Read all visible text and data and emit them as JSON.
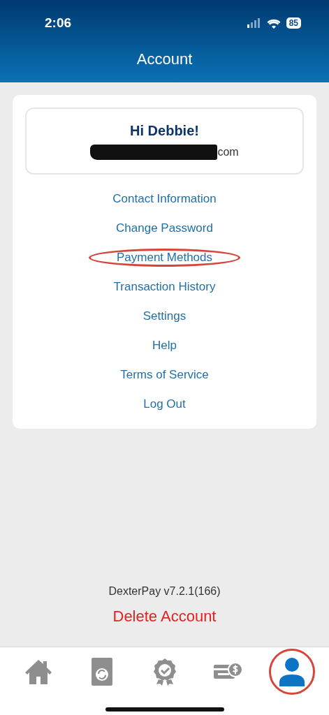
{
  "status_bar": {
    "time": "2:06",
    "battery": "85"
  },
  "header": {
    "title": "Account"
  },
  "profile": {
    "greeting": "Hi Debbie!",
    "email_visible": "com",
    "redacted": true
  },
  "menu": [
    {
      "label": "Contact Information",
      "highlighted": false
    },
    {
      "label": "Change Password",
      "highlighted": false
    },
    {
      "label": "Payment Methods",
      "highlighted": true
    },
    {
      "label": "Transaction History",
      "highlighted": false
    },
    {
      "label": "Settings",
      "highlighted": false
    },
    {
      "label": "Help",
      "highlighted": false
    },
    {
      "label": "Terms of Service",
      "highlighted": false
    },
    {
      "label": "Log Out",
      "highlighted": false
    }
  ],
  "version": "DexterPay v7.2.1(166)",
  "delete_label": "Delete Account",
  "tabs": [
    {
      "kind": "home",
      "selected": false,
      "highlighted": false
    },
    {
      "kind": "washer",
      "selected": false,
      "highlighted": false
    },
    {
      "kind": "rewards",
      "selected": false,
      "highlighted": false
    },
    {
      "kind": "payment",
      "selected": false,
      "highlighted": false
    },
    {
      "kind": "account",
      "selected": true,
      "highlighted": true
    }
  ]
}
